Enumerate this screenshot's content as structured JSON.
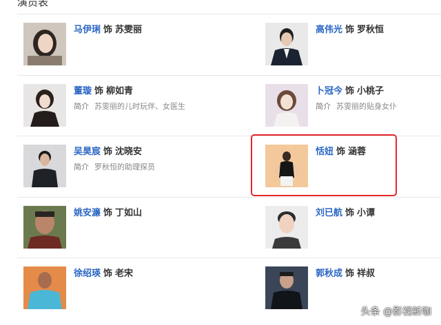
{
  "header": {
    "title": "演员表"
  },
  "cast": [
    {
      "actor": "马伊琍",
      "as": "饰",
      "role": "苏雯丽",
      "intro_label": "",
      "intro": "",
      "photo_icon": "actor-photo"
    },
    {
      "actor": "高伟光",
      "as": "饰",
      "role": "罗秋恒",
      "intro_label": "",
      "intro": "",
      "photo_icon": "actor-photo"
    },
    {
      "actor": "董璇",
      "as": "饰",
      "role": "柳如青",
      "intro_label": "简介",
      "intro": "苏雯丽的儿时玩伴、女医生",
      "photo_icon": "actor-photo"
    },
    {
      "actor": "卜冠今",
      "as": "饰",
      "role": "小桃子",
      "intro_label": "简介",
      "intro": "苏雯丽的贴身女仆",
      "photo_icon": "actor-photo"
    },
    {
      "actor": "吴昊宸",
      "as": "饰",
      "role": "沈晓安",
      "intro_label": "简介",
      "intro": "罗秋恒的助理探员",
      "photo_icon": "actor-photo"
    },
    {
      "actor": "恬妞",
      "as": "饰",
      "role": "涵蓉",
      "intro_label": "",
      "intro": "",
      "photo_icon": "actor-photo"
    },
    {
      "actor": "姚安濂",
      "as": "饰",
      "role": "丁如山",
      "intro_label": "",
      "intro": "",
      "photo_icon": "actor-photo"
    },
    {
      "actor": "刘已航",
      "as": "饰",
      "role": "小谭",
      "intro_label": "",
      "intro": "",
      "photo_icon": "actor-photo"
    },
    {
      "actor": "徐绍瑛",
      "as": "饰",
      "role": "老宋",
      "intro_label": "",
      "intro": "",
      "photo_icon": "actor-photo"
    },
    {
      "actor": "郭秋成",
      "as": "饰",
      "role": "祥叔",
      "intro_label": "",
      "intro": "",
      "photo_icon": "actor-photo"
    }
  ],
  "watermark": {
    "text": "头条 @影视新咖"
  },
  "colors": {
    "link": "#2b67c4",
    "highlight": "#e5262d",
    "divider": "#e6e6e6"
  }
}
